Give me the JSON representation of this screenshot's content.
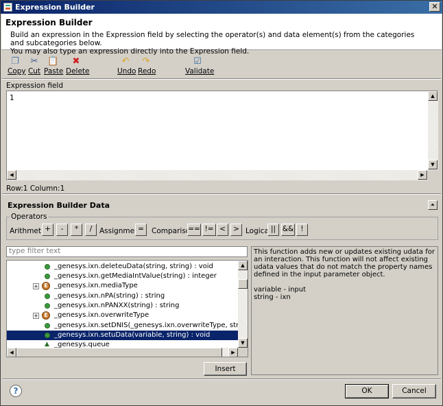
{
  "window": {
    "title": "Expression Builder"
  },
  "header": {
    "title": "Expression Builder",
    "description_line1": "Build an expression in the Expression field by selecting the operator(s) and data element(s) from the categories and subcategories below.",
    "description_line2": "You may also type an expression directly into the Expression field."
  },
  "toolbar": {
    "copy": "Copy",
    "cut": "Cut",
    "paste": "Paste",
    "delete": "Delete",
    "undo": "Undo",
    "redo": "Redo",
    "validate": "Validate"
  },
  "expression": {
    "label": "Expression field",
    "line_number": "1",
    "status": "Row:1 Column:1"
  },
  "data_section": {
    "title": "Expression Builder Data"
  },
  "operators": {
    "legend": "Operators",
    "arithmetic_label": "Arithmetic",
    "arithmetic": [
      "+",
      "-",
      "*",
      "/"
    ],
    "assignment_label": "Assignment",
    "assignment": [
      "="
    ],
    "comparison_label": "Comparison",
    "comparison": [
      "==",
      "!=",
      "<",
      ">"
    ],
    "logical_label": "Logical",
    "logical": [
      "||",
      "&&",
      "!"
    ]
  },
  "filter": {
    "placeholder": "type filter text"
  },
  "tree": {
    "items": [
      {
        "text": "_genesys.ixn.deleteuData(string, string) : void",
        "kind": "method",
        "selected": false
      },
      {
        "text": "_genesys.ixn.getMediaIntValue(string) : integer",
        "kind": "method",
        "selected": false
      },
      {
        "text": "_genesys.ixn.mediaType",
        "kind": "enum",
        "selected": false
      },
      {
        "text": "_genesys.ixn.nPA(string) : string",
        "kind": "method",
        "selected": false
      },
      {
        "text": "_genesys.ixn.nPANXX(string) : string",
        "kind": "method",
        "selected": false
      },
      {
        "text": "_genesys.ixn.overwriteType",
        "kind": "enum",
        "selected": false
      },
      {
        "text": "_genesys.ixn.setDNIS(_genesys.ixn.overwriteType, string, string",
        "kind": "method",
        "selected": false
      },
      {
        "text": "_genesys.ixn.setuData(variable, string) : void",
        "kind": "method",
        "selected": true
      },
      {
        "text": "_genesys.queue",
        "kind": "package",
        "selected": false
      }
    ]
  },
  "description": {
    "paragraph1": "This function adds new or updates existing udata for an interaction. This function will not affect existing udata values that do not match the property names defined in the input parameter object.",
    "param1": "variable - input",
    "param2": "string - ixn"
  },
  "buttons": {
    "insert": "Insert",
    "ok": "OK",
    "cancel": "Cancel"
  }
}
